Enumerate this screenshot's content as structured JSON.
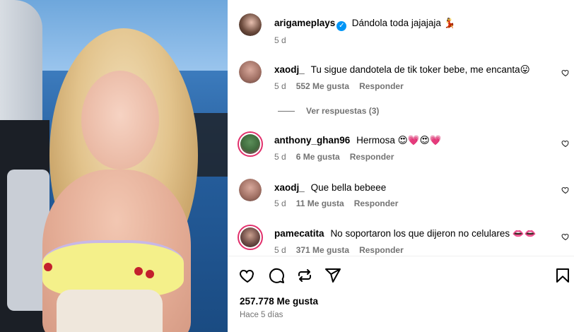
{
  "post": {
    "author": "arigameplays",
    "caption": "Dándola toda jajajaja 💃",
    "age": "5 d"
  },
  "comments": [
    {
      "user": "xaodj_",
      "text": "Tu sigue dandotela de tik toker bebe, me encanta😛",
      "age": "5 d",
      "likes": "552 Me gusta",
      "reply": "Responder",
      "view_replies": "Ver respuestas (3)"
    },
    {
      "user": "anthony_ghan96",
      "text": "Hermosa 😍💗😍💗",
      "age": "5 d",
      "likes": "6 Me gusta",
      "reply": "Responder"
    },
    {
      "user": "xaodj_",
      "text": "Que bella bebeee",
      "age": "5 d",
      "likes": "11 Me gusta",
      "reply": "Responder"
    },
    {
      "user": "pamecatita",
      "text": "No soportaron los que dijeron no celulares 👄👄",
      "age": "5 d",
      "likes": "371 Me gusta",
      "reply": "Responder"
    }
  ],
  "footer": {
    "likes": "257.778 Me gusta",
    "when": "Hace 5 días"
  },
  "icons": [
    "heart-icon",
    "comment-icon",
    "repost-icon",
    "share-icon",
    "bookmark-icon",
    "verified-icon"
  ],
  "colors": {
    "meta_gray": "#737373",
    "verified_blue": "#0095f6",
    "story_ring": "#e1306c"
  }
}
